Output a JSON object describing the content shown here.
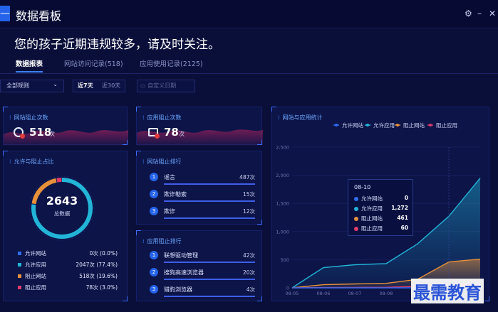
{
  "window": {
    "title": "数据看板",
    "menu_glyph": "—",
    "settings_glyph": "⚙",
    "minimize_glyph": "–",
    "close_glyph": "✕"
  },
  "alert": "您的孩子近期违规较多，请及时关注。",
  "tabs": [
    {
      "label": "数据报表",
      "active": true
    },
    {
      "label": "网站访问记录(518)",
      "active": false
    },
    {
      "label": "应用使用记录(2125)",
      "active": false
    }
  ],
  "filters": {
    "rule_select": "全部规则",
    "rule_arrow": "⌄",
    "range_7": "近7天",
    "range_30": "近30天",
    "custom_date_placeholder": "自定义日期"
  },
  "stats": {
    "site_block": {
      "title": "网站阻止次数",
      "value": "518",
      "unit": "次"
    },
    "app_block": {
      "title": "应用阻止次数",
      "value": "78",
      "unit": "次"
    }
  },
  "allow_block": {
    "title": "允许与阻止占比",
    "total": "2643",
    "total_label": "总数据",
    "legend": [
      {
        "name": "允许网站",
        "value": "0次 (0.0%)",
        "color": "#2f6df0",
        "percent": 0.0
      },
      {
        "name": "允许应用",
        "value": "2047次 (77.4%)",
        "color": "#22b5d8",
        "percent": 77.4
      },
      {
        "name": "阻止网站",
        "value": "518次 (19.6%)",
        "color": "#e7903a",
        "percent": 19.6
      },
      {
        "name": "阻止应用",
        "value": "78次 (3.0%)",
        "color": "#e33b6d",
        "percent": 3.0
      }
    ]
  },
  "site_rank": {
    "title": "网站阻止排行",
    "items": [
      {
        "no": "1",
        "name": "谣言",
        "value": "487次"
      },
      {
        "no": "2",
        "name": "欺诈勒索",
        "value": "15次"
      },
      {
        "no": "3",
        "name": "欺诈",
        "value": "12次"
      }
    ]
  },
  "app_rank": {
    "title": "应用阻止排行",
    "items": [
      {
        "no": "1",
        "name": "联想驱动管理",
        "value": "42次"
      },
      {
        "no": "2",
        "name": "搜狗高速浏览器",
        "value": "20次"
      },
      {
        "no": "3",
        "name": "猎豹浏览器",
        "value": "4次"
      }
    ]
  },
  "trend": {
    "title": "网站与应用统计"
  },
  "chart_data": {
    "type": "area",
    "title": "网站与应用统计",
    "x": [
      "08-05",
      "08-06",
      "08-07",
      "08-08",
      "08-09",
      "08-10",
      "08-11"
    ],
    "x_visible_ticks": [
      "08-05",
      "08-06",
      "08-07",
      "08-08",
      "08-09"
    ],
    "y_ticks": [
      "0",
      "500",
      "1,000",
      "1,500",
      "2,000",
      "2,500"
    ],
    "ylim": [
      0,
      2500
    ],
    "legend_placement": "top",
    "series": [
      {
        "name": "允许网站",
        "color": "#2f6df0",
        "values": [
          0,
          0,
          0,
          0,
          0,
          0,
          0
        ]
      },
      {
        "name": "允许应用",
        "color": "#22b5d8",
        "values": [
          0,
          360,
          410,
          430,
          780,
          1272,
          1950
        ]
      },
      {
        "name": "阻止网站",
        "color": "#e7903a",
        "values": [
          0,
          55,
          70,
          80,
          150,
          461,
          510
        ]
      },
      {
        "name": "阻止应用",
        "color": "#e33b6d",
        "values": [
          0,
          5,
          8,
          10,
          25,
          60,
          70
        ]
      }
    ],
    "tooltip": {
      "date": "08-10",
      "rows": [
        {
          "name": "允许网站",
          "value": "0",
          "color": "#2f6df0"
        },
        {
          "name": "允许应用",
          "value": "1,272",
          "color": "#22b5d8"
        },
        {
          "name": "阻止网站",
          "value": "461",
          "color": "#e7903a"
        },
        {
          "name": "阻止应用",
          "value": "60",
          "color": "#e33b6d"
        }
      ]
    }
  },
  "watermark": "最需教育"
}
